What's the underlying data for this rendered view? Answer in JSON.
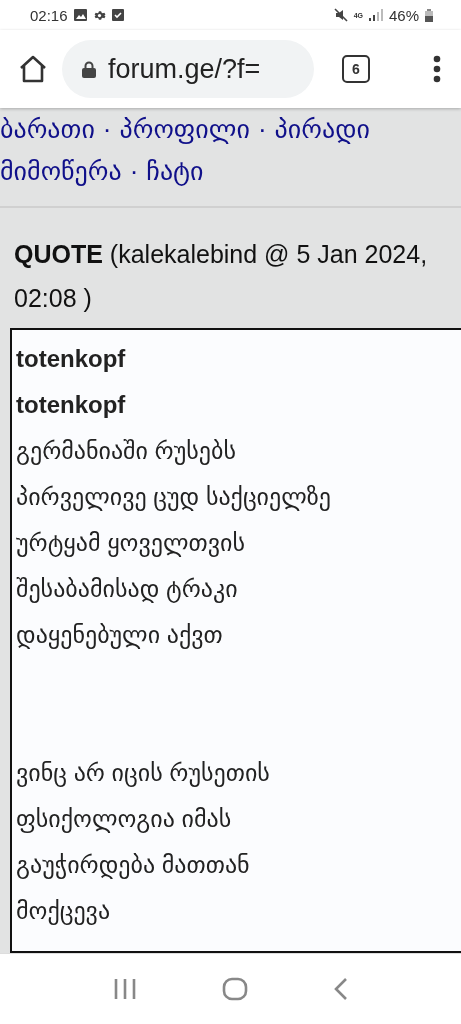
{
  "status_bar": {
    "time": "02:16",
    "battery": "46%",
    "network": "4G"
  },
  "browser": {
    "url": "forum.ge/?f=",
    "tab_count": "6"
  },
  "nav_lines": [
    [
      "ბარათი",
      "პროფილი",
      "პირადი"
    ],
    [
      "მიმოწერა",
      "ჩატი"
    ]
  ],
  "nav_separator": "·",
  "quote": {
    "label": "QUOTE",
    "meta": "(kalekalebind @ 5 Jan 2024, 02:08 )",
    "authors": [
      "totenkopf",
      "totenkopf"
    ],
    "paragraphs": [
      [
        "გერმანიაში რუსებს",
        "პირველივე ცუდ საქციელზე",
        "ურტყამ ყოველთვის",
        "შესაბამისად ტრაკი",
        "დაყენებული აქვთ"
      ],
      [
        "ვინც არ იცის რუსეთის",
        "ფსიქოლოგია იმას",
        "გაუჭირდება მათთან",
        "მოქცევა"
      ]
    ]
  }
}
